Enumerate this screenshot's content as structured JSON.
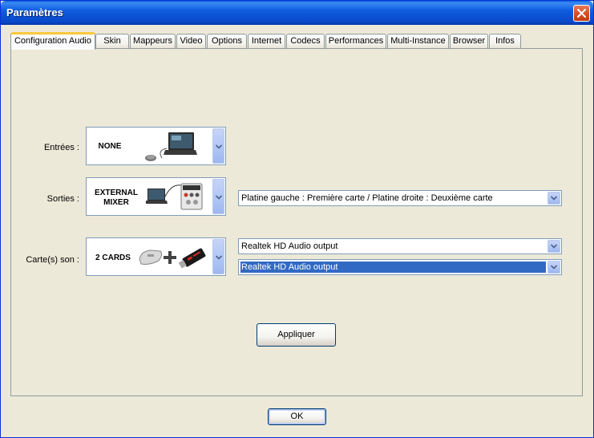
{
  "window": {
    "title": "Paramètres"
  },
  "tabs": [
    {
      "label": "Configuration Audio",
      "active": true
    },
    {
      "label": "Skin"
    },
    {
      "label": "Mappeurs"
    },
    {
      "label": "Video"
    },
    {
      "label": "Options"
    },
    {
      "label": "Internet"
    },
    {
      "label": "Codecs"
    },
    {
      "label": "Performances"
    },
    {
      "label": "Multi-Instance"
    },
    {
      "label": "Browser"
    },
    {
      "label": "Infos"
    }
  ],
  "audio": {
    "inputs": {
      "label": "Entrées :",
      "selection": "NONE",
      "icon": "laptop-with-mouse-icon"
    },
    "outputs": {
      "label": "Sorties :",
      "selection_line1": "EXTERNAL",
      "selection_line2": "MIXER",
      "icon": "laptop-mixer-icon",
      "routing_value": "Platine gauche : Première carte / Platine droite : Deuxième carte"
    },
    "soundcards": {
      "label": "Carte(s) son :",
      "selection": "2 CARDS",
      "icon": "two-soundcards-icon",
      "card1_value": "Realtek HD Audio output",
      "card2_value": "Realtek HD Audio output"
    }
  },
  "buttons": {
    "apply": "Appliquer",
    "ok": "OK"
  },
  "colors": {
    "titlebar": "#0848C8",
    "selection": "#316AC5",
    "tab_highlight": "#FFC83C"
  }
}
